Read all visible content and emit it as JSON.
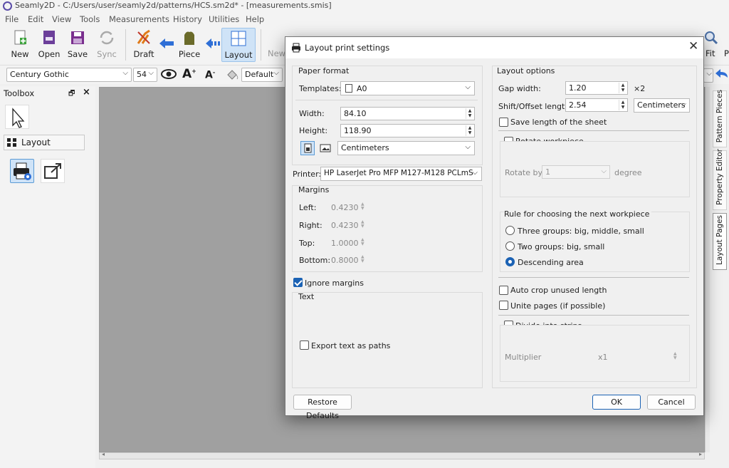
{
  "window": {
    "title": "Seamly2D - C:/Users/user/seamly2d/patterns/HCS.sm2d* - [measurements.smis]"
  },
  "menu": [
    "File",
    "Edit",
    "View",
    "Tools",
    "Measurements",
    "History",
    "Utilities",
    "Help"
  ],
  "toolbar": {
    "new": "New",
    "open": "Open",
    "save": "Save",
    "sync": "Sync",
    "draft": "Draft",
    "piece": "Piece",
    "layout": "Layout",
    "new_trunc": "New",
    "fit": "Fit",
    "trunc_p": "P"
  },
  "fontbar": {
    "font": "Century Gothic",
    "size": "54",
    "style": "Default"
  },
  "toolbox": {
    "title": "Toolbox",
    "layout_label": "Layout"
  },
  "side_tabs": [
    "Pattern Pieces",
    "Property Editor",
    "Layout Pages"
  ],
  "dialog": {
    "title": "Layout print settings",
    "paper_format": {
      "title": "Paper format",
      "templates_label": "Templates:",
      "template": "A0",
      "width_label": "Width:",
      "width": "84.10",
      "height_label": "Height:",
      "height": "118.90",
      "units": "Centimeters"
    },
    "printer": {
      "label": "Printer:",
      "value": "HP LaserJet Pro MFP M127-M128 PCLmS"
    },
    "margins": {
      "title": "Margins",
      "left_label": "Left:",
      "left": "0.4230",
      "right_label": "Right:",
      "right": "0.4230",
      "top_label": "Top:",
      "top": "1.0000",
      "bottom_label": "Bottom:",
      "bottom": "0.8000"
    },
    "ignore_margins": "Ignore margins",
    "text": {
      "title": "Text",
      "export_paths": "Export text as paths"
    },
    "layout_options": {
      "title": "Layout options",
      "gap_label": "Gap width:",
      "gap": "1.20",
      "gap_suffix": "×2",
      "shift_label": "Shift/Offset length:",
      "shift": "2.54",
      "shift_units": "Centimeters",
      "save_length": "Save length of the sheet",
      "rotate": "Rotate workpiece",
      "rotate_by_label": "Rotate by",
      "rotate_by": "1",
      "degree": "degree",
      "rule_title": "Rule for choosing the next workpiece",
      "rule_three": "Three groups: big, middle, small",
      "rule_two": "Two groups: big, small",
      "rule_desc": "Descending area",
      "auto_crop": "Auto crop unused length",
      "unite": "Unite pages (if possible)",
      "strips": "Divide into strips",
      "multiplier_label": "Multiplier",
      "multiplier": "x1"
    },
    "buttons": {
      "restore": "Restore Defaults",
      "ok": "OK",
      "cancel": "Cancel"
    }
  },
  "colors": {
    "accent": "#1b62b4",
    "canvas": "#a0a0a0",
    "arrow": "#2f6fd6"
  }
}
